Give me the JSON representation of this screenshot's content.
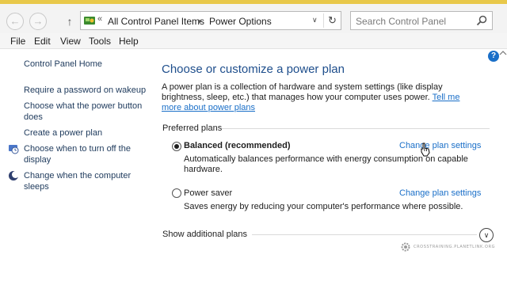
{
  "window": {
    "accent_color": "#e8c84a"
  },
  "navigation": {
    "back_icon": "back-arrow-icon",
    "forward_icon": "forward-arrow-icon",
    "up_icon": "up-arrow-icon",
    "breadcrumb": [
      "All Control Panel Items",
      "Power Options"
    ],
    "refresh_icon": "refresh-icon"
  },
  "search": {
    "placeholder": "Search Control Panel",
    "icon": "search-icon"
  },
  "menu": {
    "items": [
      "File",
      "Edit",
      "View",
      "Tools",
      "Help"
    ]
  },
  "sidebar": {
    "home": "Control Panel Home",
    "items": [
      {
        "label": "Require a password on wakeup",
        "icon": ""
      },
      {
        "label": "Choose what the power button does",
        "icon": ""
      },
      {
        "label": "Create a power plan",
        "icon": ""
      },
      {
        "label": "Choose when to turn off the display",
        "icon": "display-clock-icon"
      },
      {
        "label": "Change when the computer sleeps",
        "icon": "moon-icon"
      }
    ]
  },
  "main": {
    "heading": "Choose or customize a power plan",
    "description": "A power plan is a collection of hardware and system settings (like display brightness, sleep, etc.) that manages how your computer uses power.",
    "description_link": "Tell me more about power plans",
    "preferred_plans_title": "Preferred plans",
    "plans": [
      {
        "name": "Balanced (recommended)",
        "selected": true,
        "description": "Automatically balances performance with energy consumption on capable hardware.",
        "change_link": "Change plan settings"
      },
      {
        "name": "Power saver",
        "selected": false,
        "description": "Saves energy by reducing your computer's performance where possible.",
        "change_link": "Change plan settings"
      }
    ],
    "show_more": "Show additional plans"
  },
  "watermark": {
    "text": "CROSSTRAINING.PLANETLINK.ORG"
  },
  "colors": {
    "link": "#1a6fc8",
    "heading": "#1e4e8c"
  }
}
